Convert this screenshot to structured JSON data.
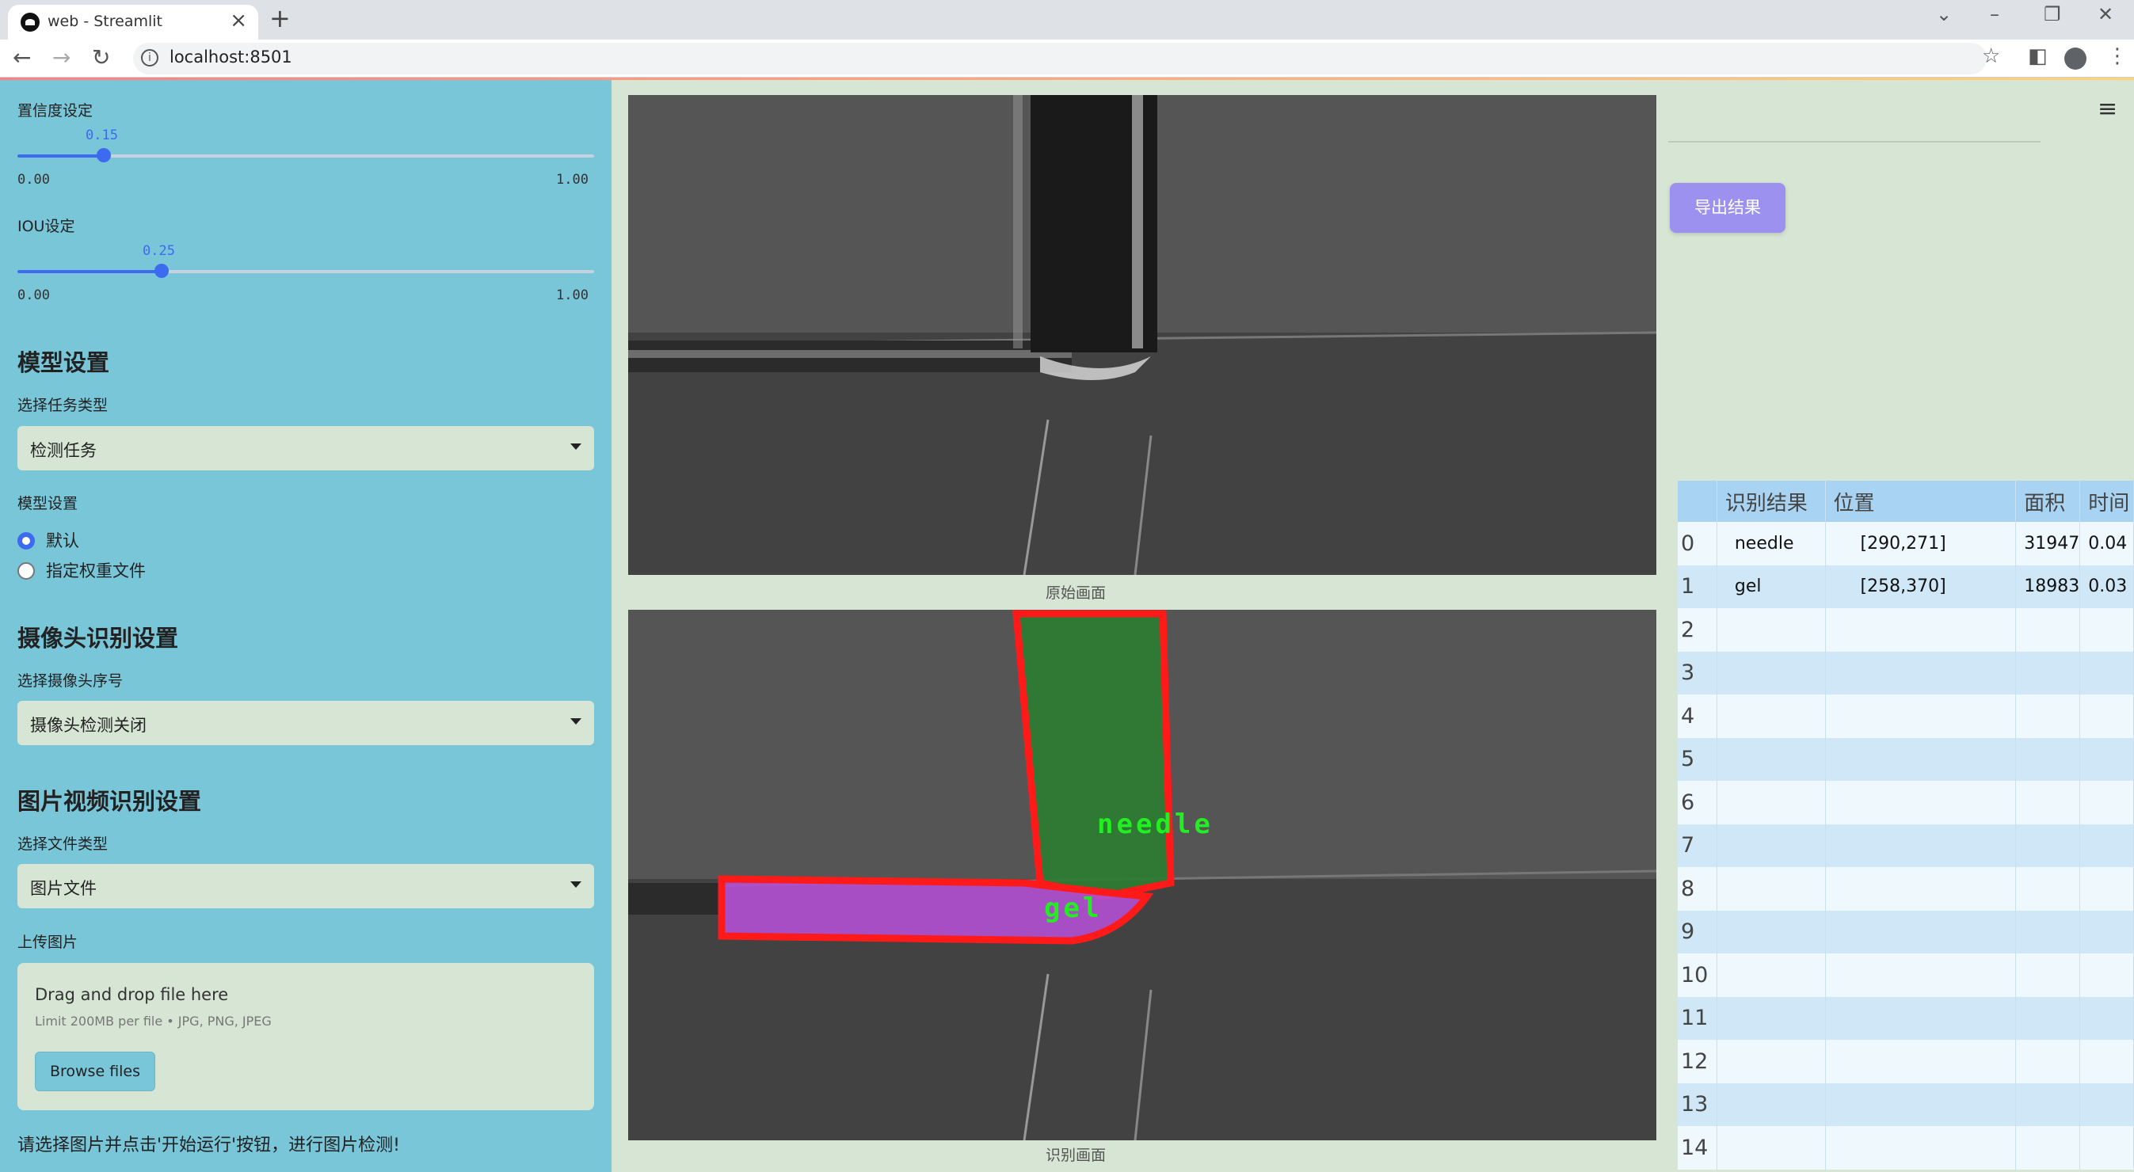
{
  "browser": {
    "tab_title": "web - Streamlit",
    "url": "localhost:8501"
  },
  "sidebar": {
    "confidence": {
      "label": "置信度设定",
      "value": "0.15",
      "min": "0.00",
      "max": "1.00",
      "fraction": 0.15
    },
    "iou": {
      "label": "IOU设定",
      "value": "0.25",
      "min": "0.00",
      "max": "1.00",
      "fraction": 0.25
    },
    "model_section": {
      "heading": "模型设置",
      "task_label": "选择任务类型",
      "task_value": "检测任务",
      "model_label": "模型设置",
      "radio_options": [
        "默认",
        "指定权重文件"
      ],
      "radio_selected": 0
    },
    "camera_section": {
      "heading": "摄像头识别设置",
      "camera_label": "选择摄像头序号",
      "camera_value": "摄像头检测关闭"
    },
    "media_section": {
      "heading": "图片视频识别设置",
      "file_type_label": "选择文件类型",
      "file_type_value": "图片文件",
      "upload_label": "上传图片",
      "drop_title": "Drag and drop file here",
      "drop_limit": "Limit 200MB per file • JPG, PNG, JPEG",
      "browse_label": "Browse files"
    },
    "hint": "请选择图片并点击'开始运行'按钮，进行图片检测!"
  },
  "main": {
    "original_caption": "原始画面",
    "detected_caption": "识别画面",
    "detection_labels": {
      "needle": "needle",
      "gel": "gel"
    },
    "colors": {
      "needle_fill": "#2e7d32",
      "gel_fill": "#b04fd0",
      "box_stroke": "#ff1a1a",
      "label_text": "#22ee22"
    }
  },
  "panel": {
    "export_button": "导出结果",
    "table": {
      "headers": [
        "",
        "识别结果",
        "位置",
        "面积",
        "时间"
      ],
      "rows": [
        [
          "0",
          "needle",
          "[290,271]",
          "31947",
          "0.04"
        ],
        [
          "1",
          "gel",
          "[258,370]",
          "18983",
          "0.03"
        ],
        [
          "2",
          "",
          "",
          "",
          ""
        ],
        [
          "3",
          "",
          "",
          "",
          ""
        ],
        [
          "4",
          "",
          "",
          "",
          ""
        ],
        [
          "5",
          "",
          "",
          "",
          ""
        ],
        [
          "6",
          "",
          "",
          "",
          ""
        ],
        [
          "7",
          "",
          "",
          "",
          ""
        ],
        [
          "8",
          "",
          "",
          "",
          ""
        ],
        [
          "9",
          "",
          "",
          "",
          ""
        ],
        [
          "10",
          "",
          "",
          "",
          ""
        ],
        [
          "11",
          "",
          "",
          "",
          ""
        ],
        [
          "12",
          "",
          "",
          "",
          ""
        ],
        [
          "13",
          "",
          "",
          "",
          ""
        ],
        [
          "14",
          "",
          "",
          "",
          ""
        ]
      ]
    }
  }
}
